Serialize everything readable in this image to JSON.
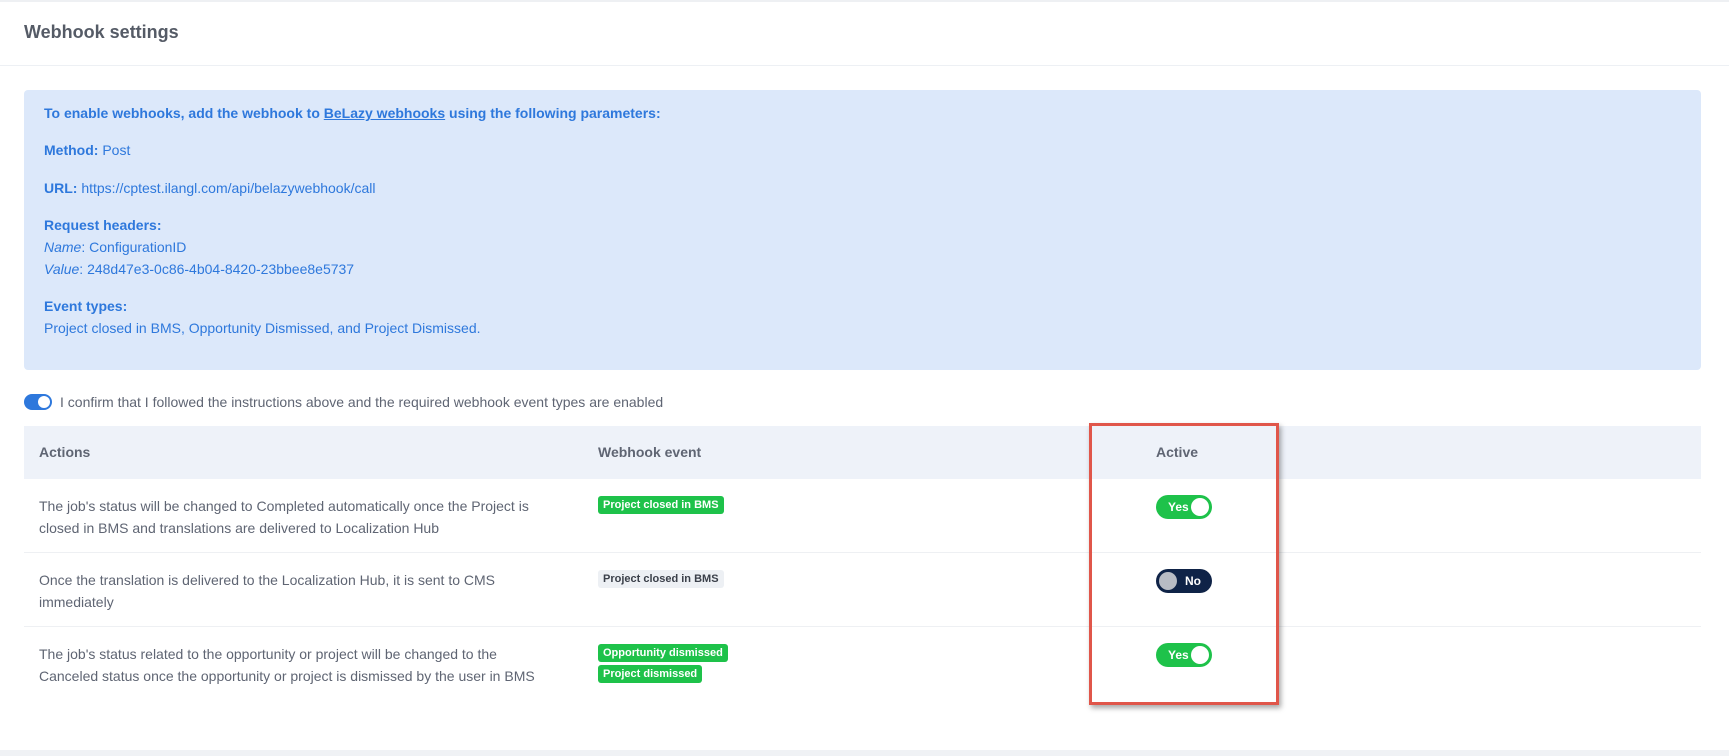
{
  "header": {
    "title": "Webhook settings"
  },
  "info": {
    "intro_prefix": "To enable webhooks, add the webhook to ",
    "intro_link": "BeLazy webhooks",
    "intro_suffix": " using the following parameters:",
    "method_label": "Method:",
    "method_value": "Post",
    "url_label": "URL:",
    "url_value": "https://cptest.ilangl.com/api/belazywebhook/call",
    "headers_label": "Request headers:",
    "name_key": "Name",
    "name_value": ": ConfigurationID",
    "value_key": "Value",
    "value_value": ": 248d47e3-0c86-4b04-8420-23bbee8e5737",
    "event_types_label": "Event types:",
    "event_types_value": "Project closed in BMS, Opportunity Dismissed, and Project Dismissed."
  },
  "confirm": {
    "checked": true,
    "text": "I confirm that I followed the instructions above and the required webhook event types are enabled"
  },
  "table": {
    "headers": {
      "actions": "Actions",
      "event": "Webhook event",
      "active": "Active"
    },
    "rows": [
      {
        "action": "The job's status will be changed to Completed automatically once the Project is closed in BMS and translations are delivered to Localization Hub",
        "events": [
          "Project closed in BMS"
        ],
        "active": true,
        "toggle_label": "Yes"
      },
      {
        "action": "Once the translation is delivered to the Localization Hub, it is sent to CMS immediately",
        "events": [
          "Project closed in BMS"
        ],
        "active": false,
        "toggle_label": "No"
      },
      {
        "action": "The job's status related to the opportunity or project will be changed to the Canceled status once the opportunity or project is dismissed by the user in BMS",
        "events": [
          "Opportunity dismissed",
          "Project dismissed"
        ],
        "active": true,
        "toggle_label": "Yes"
      }
    ]
  },
  "colors": {
    "accent": "#2e78dc",
    "info_bg": "#dce8fa",
    "badge_green": "#1ec24a",
    "toggle_off": "#0f2347",
    "highlight": "#e0564a"
  }
}
